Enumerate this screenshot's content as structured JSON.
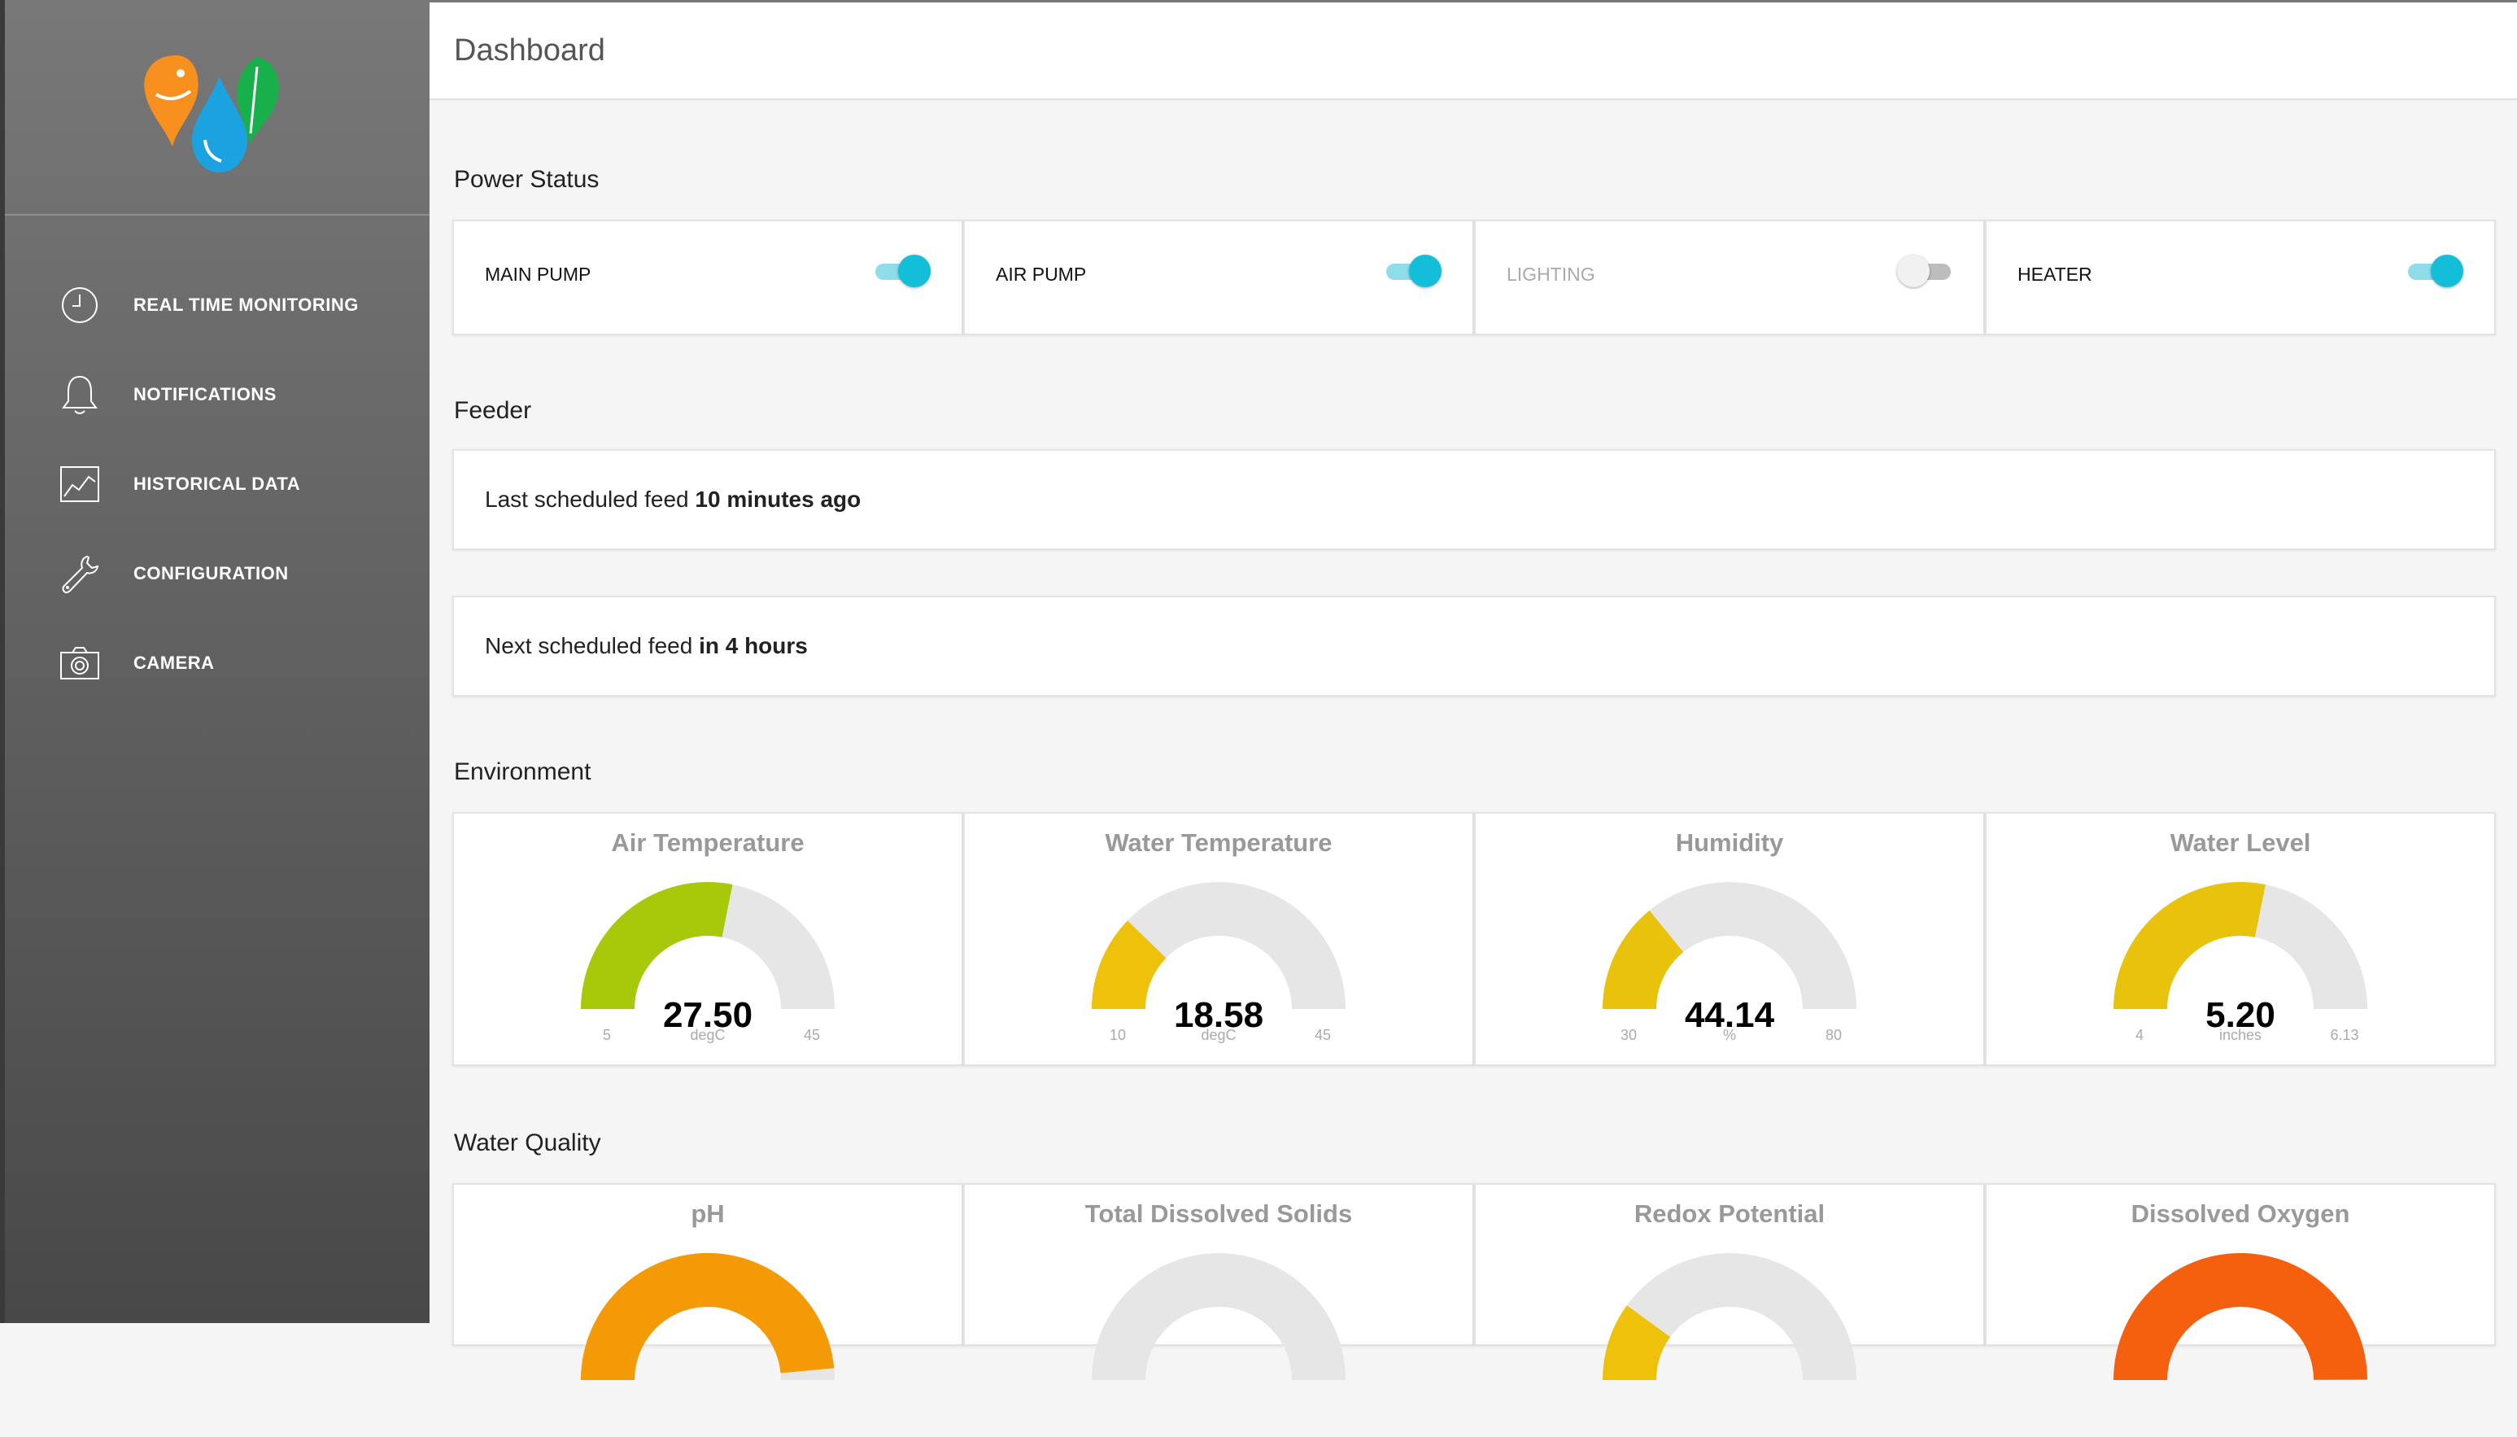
{
  "header": {
    "title": "Dashboard"
  },
  "sidebar": {
    "items": [
      {
        "label": "REAL TIME MONITORING",
        "icon": "clock-icon"
      },
      {
        "label": "NOTIFICATIONS",
        "icon": "bell-icon"
      },
      {
        "label": "HISTORICAL DATA",
        "icon": "chart-icon"
      },
      {
        "label": "CONFIGURATION",
        "icon": "wrench-icon"
      },
      {
        "label": "CAMERA",
        "icon": "camera-icon"
      }
    ]
  },
  "power": {
    "title": "Power Status",
    "items": [
      {
        "label": "MAIN PUMP",
        "on": true
      },
      {
        "label": "AIR PUMP",
        "on": true
      },
      {
        "label": "LIGHTING",
        "on": false
      },
      {
        "label": "HEATER",
        "on": true
      }
    ]
  },
  "feeder": {
    "title": "Feeder",
    "last": {
      "prefix": "Last scheduled feed",
      "value": "10 minutes ago"
    },
    "next": {
      "prefix": "Next scheduled feed",
      "value": "in 4 hours"
    }
  },
  "environment": {
    "title": "Environment",
    "gauges": [
      {
        "title": "Air Temperature",
        "value": "27.50",
        "unit": "degC",
        "min": "5",
        "max": "45",
        "color": "#a8c90a"
      },
      {
        "title": "Water Temperature",
        "value": "18.58",
        "unit": "degC",
        "min": "10",
        "max": "45",
        "color": "#eec20a"
      },
      {
        "title": "Humidity",
        "value": "44.14",
        "unit": "%",
        "min": "30",
        "max": "80",
        "color": "#e9c30b"
      },
      {
        "title": "Water Level",
        "value": "5.20",
        "unit": "inches",
        "min": "4",
        "max": "6.13",
        "color": "#e9c30b"
      }
    ]
  },
  "water_quality": {
    "title": "Water Quality",
    "gauges": [
      {
        "title": "pH",
        "fraction": 0.97,
        "color": "#f59a07"
      },
      {
        "title": "Total Dissolved Solids",
        "fraction": 0.0,
        "color": "#e5e5e5"
      },
      {
        "title": "Redox Potential",
        "fraction": 0.2,
        "color": "#eec20a"
      },
      {
        "title": "Dissolved Oxygen",
        "fraction": 1.0,
        "color": "#f4600e"
      }
    ]
  }
}
